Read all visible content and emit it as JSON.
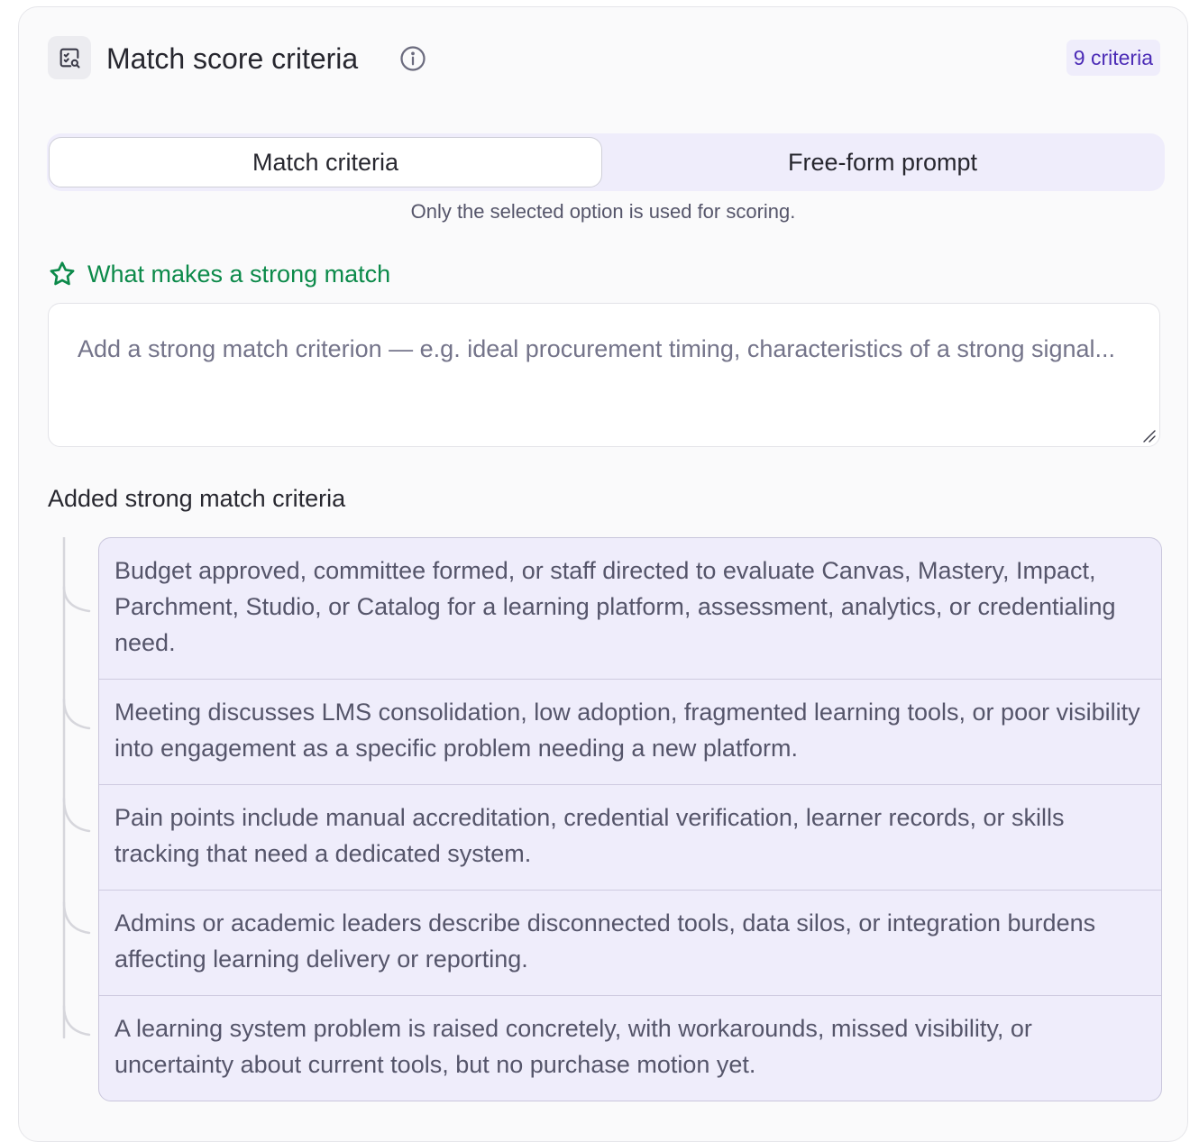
{
  "header": {
    "title": "Match score criteria",
    "badge": "9 criteria"
  },
  "tabs": [
    {
      "label": "Match criteria",
      "active": true
    },
    {
      "label": "Free-form prompt",
      "active": false
    }
  ],
  "helper_text": "Only the selected option is used for scoring.",
  "strong_match": {
    "heading": "What makes a strong match",
    "placeholder": "Add a strong match criterion — e.g. ideal procurement timing, characteristics of a strong signal...",
    "value": "",
    "added_label": "Added strong match criteria",
    "items": [
      "Budget approved, committee formed, or staff directed to evaluate Canvas, Mastery, Impact, Parchment, Studio, or Catalog for a learning platform, assessment, analytics, or credentialing need.",
      "Meeting discusses LMS consolidation, low adoption, fragmented learning tools, or poor visibility into engagement as a specific problem needing a new platform.",
      "Pain points include manual accreditation, credential verification, learner records, or skills tracking that need a dedicated system.",
      "Admins or academic leaders describe disconnected tools, data silos, or integration burdens affecting learning delivery or reporting.",
      "A learning system problem is raised concretely, with workarounds, missed visibility, or uncertainty about current tools, but no purchase motion yet."
    ]
  },
  "colors": {
    "accent_green": "#0c8a4a",
    "badge_purple": "#4b2bb6",
    "criteria_bg": "#efedfb"
  },
  "icons": {
    "header": "scan-search-icon",
    "info": "info-icon",
    "section": "star-icon"
  }
}
